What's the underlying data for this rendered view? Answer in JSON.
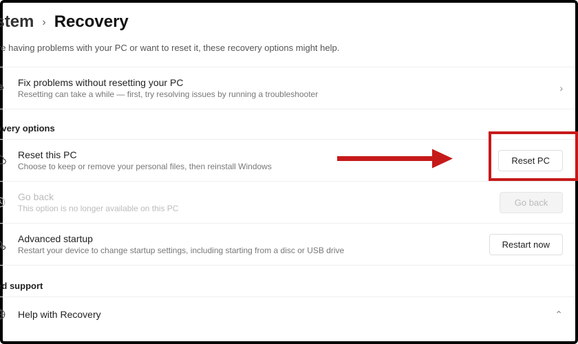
{
  "breadcrumb": {
    "parent_partial": "ystem",
    "current": "Recovery"
  },
  "intro_partial": "ou're having problems with your PC or want to reset it, these recovery options might help.",
  "fixproblems": {
    "title": "Fix problems without resetting your PC",
    "desc": "Resetting can take a while — first, try resolving issues by running a troubleshooter"
  },
  "section_recovery_label_partial": "ecovery options",
  "reset": {
    "title": "Reset this PC",
    "desc": "Choose to keep or remove your personal files, then reinstall Windows",
    "button": "Reset PC"
  },
  "goback": {
    "title": "Go back",
    "desc": "This option is no longer available on this PC",
    "button": "Go back"
  },
  "advanced": {
    "title": "Advanced startup",
    "desc": "Restart your device to change startup settings, including starting from a disc or USB drive",
    "button": "Restart now"
  },
  "section_support_label_partial": "lated support",
  "help": {
    "title": "Help with Recovery"
  }
}
